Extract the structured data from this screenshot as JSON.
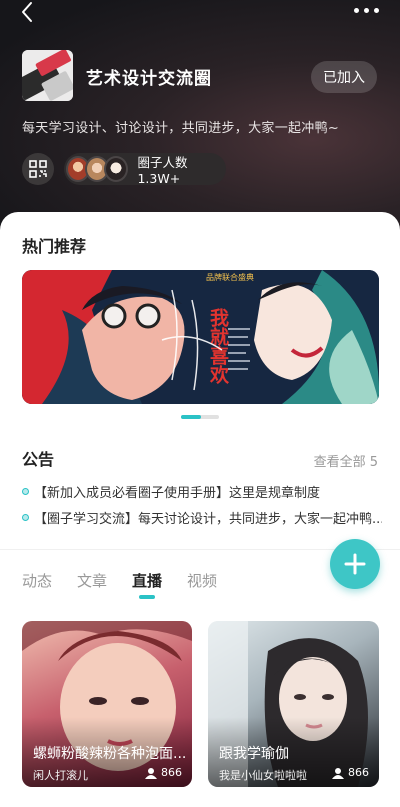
{
  "header": {
    "group_title": "艺术设计交流圈",
    "joined_label": "已加入",
    "description": "每天学习设计、讨论设计，共同进步，大家一起冲鸭~",
    "member_count_label": "圈子人数 1.3W+"
  },
  "recommend": {
    "title": "热门推荐",
    "banner_text": {
      "headline": "品牌联合盛典",
      "slogan": "我就喜欢"
    },
    "pager_index": 0,
    "pager_total": 2
  },
  "notice": {
    "title": "公告",
    "view_all": "查看全部 5",
    "items": [
      "【新加入成员必看圈子使用手册】这里是规章制度",
      "【圈子学习交流】每天讨论设计，共同进步，大家一起冲鸭..."
    ]
  },
  "tabs": [
    {
      "label": "动态",
      "active": false
    },
    {
      "label": "文章",
      "active": false
    },
    {
      "label": "直播",
      "active": true
    },
    {
      "label": "视频",
      "active": false
    }
  ],
  "live_cards": [
    {
      "title": "螺蛳粉酸辣粉各种泡面...",
      "author": "闲人打滚儿",
      "views": "866"
    },
    {
      "title": "跟我学瑜伽",
      "author": "我是小仙女啦啦啦",
      "views": "866"
    }
  ],
  "icons": {
    "back": "back-arrow-icon",
    "more": "more-dots-icon",
    "qr": "qr-code-icon",
    "add": "plus-icon",
    "viewer": "viewer-icon"
  },
  "colors": {
    "accent": "#2bc2c6",
    "fab": "#3ec6c6",
    "header_bg": "#1c1a1b"
  }
}
